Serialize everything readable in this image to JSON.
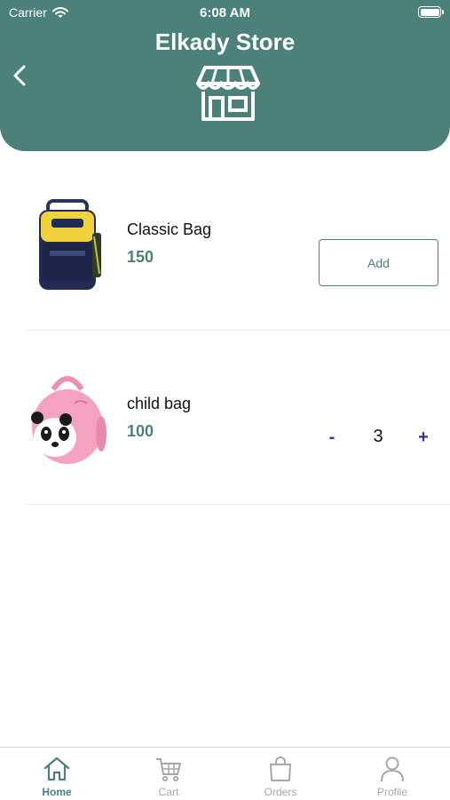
{
  "status_bar": {
    "carrier": "Carrier",
    "time": "6:08 AM"
  },
  "header": {
    "title": "Elkady Store",
    "back_icon": "chevron-left-icon",
    "store_icon": "storefront-icon",
    "color": "#4b8179"
  },
  "products": [
    {
      "name": "Classic Bag",
      "price": "150",
      "image": "backpack-navy-yellow",
      "action": "add",
      "action_label": "Add"
    },
    {
      "name": "child bag",
      "price": "100",
      "image": "backpack-pink-panda",
      "action": "stepper",
      "minus_label": "-",
      "quantity": "3",
      "plus_label": "+"
    }
  ],
  "tabbar": {
    "tabs": [
      {
        "label": "Home",
        "icon": "home-icon",
        "active": true
      },
      {
        "label": "Cart",
        "icon": "cart-icon",
        "active": false
      },
      {
        "label": "Orders",
        "icon": "shopping-bag-icon",
        "active": false
      },
      {
        "label": "Profile",
        "icon": "person-icon",
        "active": false
      }
    ],
    "active_color": "#4b8179",
    "inactive_color": "#a7a7a7"
  }
}
